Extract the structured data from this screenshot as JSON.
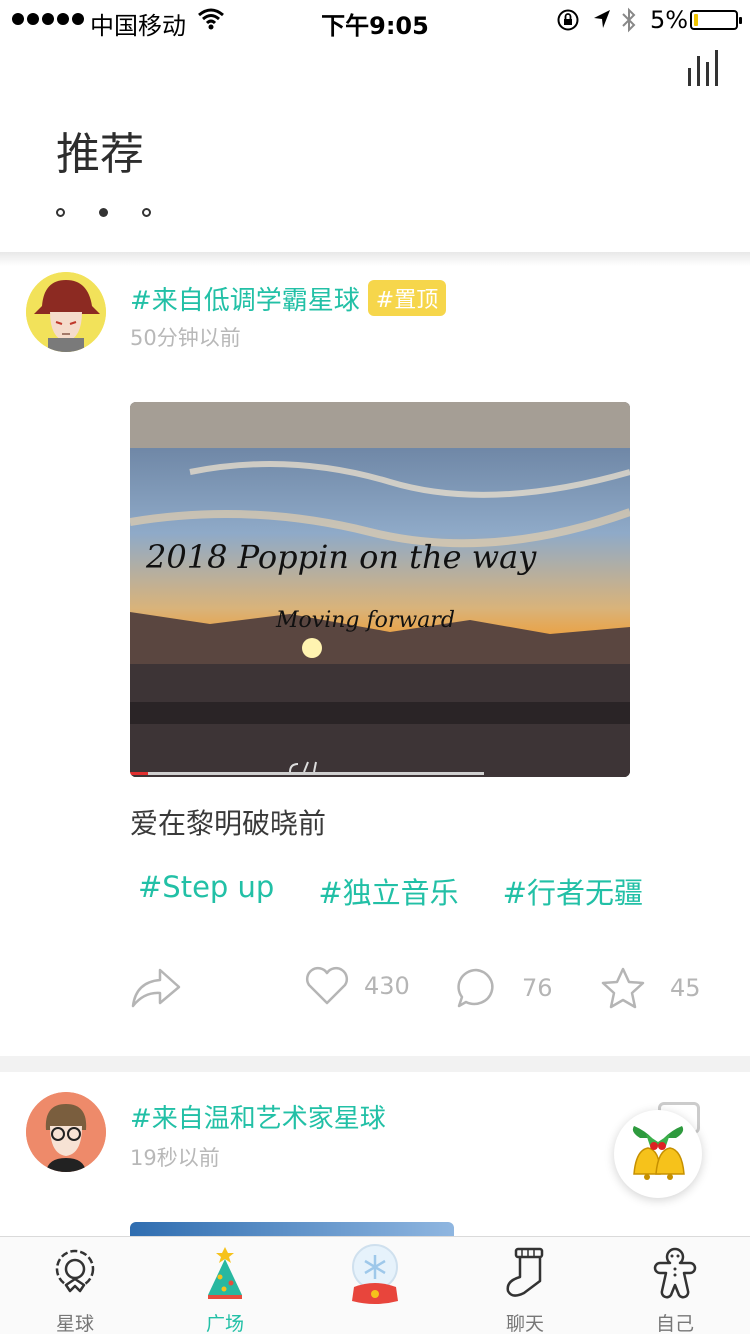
{
  "status_bar": {
    "carrier": "中国移动",
    "time": "下午9:05",
    "battery": "5%",
    "battery_level": 0.05
  },
  "header": {
    "title": "推荐",
    "page_indicator_count": 3,
    "active_page": 2
  },
  "posts": [
    {
      "topic": "#来自低调学霸星球",
      "badge": "#置顶",
      "time": "50分钟以前",
      "media_title": "2018 Poppin on the way",
      "media_subtitle": "Moving forward",
      "caption": "爱在黎明破晓前",
      "tags": [
        "#Step up",
        "#独立音乐",
        "#行者无疆"
      ],
      "likes": "430",
      "comments": "76",
      "favorites": "45"
    },
    {
      "topic": "#来自温和艺术家星球",
      "time": "19秒以前"
    }
  ],
  "tabs": [
    {
      "label": "星球",
      "icon": "wreath-icon"
    },
    {
      "label": "广场",
      "icon": "christmas-tree-icon"
    },
    {
      "label": "",
      "icon": "snow-globe-icon"
    },
    {
      "label": "聊天",
      "icon": "stocking-icon"
    },
    {
      "label": "自己",
      "icon": "gingerbread-man-icon"
    }
  ],
  "colors": {
    "accent": "#22c0a6",
    "badge": "#f6d64b",
    "muted": "#b8b8b8"
  }
}
